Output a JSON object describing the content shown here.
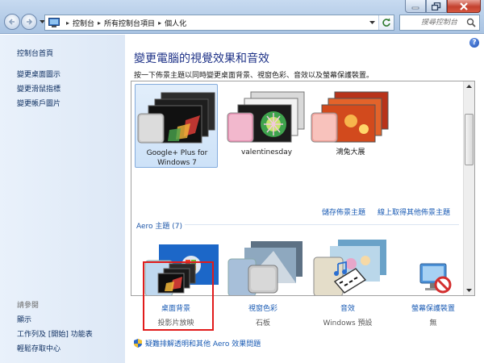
{
  "window": {
    "breadcrumb": [
      "控制台",
      "所有控制台項目",
      "個人化"
    ],
    "search_placeholder": "搜尋控制台"
  },
  "sidebar": {
    "home": "控制台首頁",
    "links": [
      "變更桌面圖示",
      "變更滑鼠指標",
      "變更帳戶圖片"
    ],
    "see_also_heading": "請參閱",
    "see_also": [
      "顯示",
      "工作列及 [開始] 功能表",
      "輕鬆存取中心"
    ]
  },
  "main": {
    "title": "變更電腦的視覺效果和音效",
    "description": "按一下佈景主題以同時變更桌面背景、視窗色彩、音效以及螢幕保護裝置。",
    "my_themes": [
      {
        "name": "Google+ Plus for Windows 7",
        "selected": true
      },
      {
        "name": "valentinesday",
        "selected": false
      },
      {
        "name": "鴻兔大展",
        "selected": false
      }
    ],
    "save_theme": "儲存佈景主題",
    "online_themes": "線上取得其他佈景主題",
    "aero_heading": "Aero 主題 (7)",
    "tools": [
      {
        "label": "桌面背景",
        "sub": "投影片放映"
      },
      {
        "label": "視窗色彩",
        "sub": "石板"
      },
      {
        "label": "音效",
        "sub": "Windows 預設"
      },
      {
        "label": "螢幕保護裝置",
        "sub": "無"
      }
    ],
    "troubleshoot": "疑難排解透明和其他 Aero 效果問題"
  },
  "colors": {
    "link": "#1a5bb4",
    "title": "#1e3287",
    "highlight": "#e11b1b",
    "sidebar_bg": "#e4eefa"
  }
}
